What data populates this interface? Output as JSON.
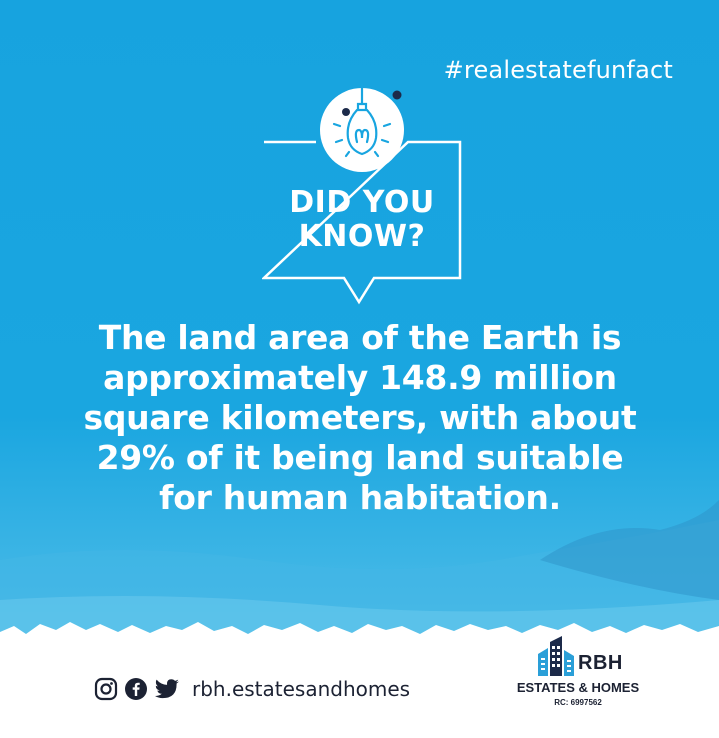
{
  "colors": {
    "sky": "#18a5e0",
    "white": "#ffffff",
    "navy": "#1c2a4a",
    "text_dark": "#1c2233",
    "logo_blue": "#2a9fd8"
  },
  "hashtag": "#realestatefunfact",
  "badge": {
    "line1": "DID YOU",
    "line2": "KNOW?"
  },
  "fact": {
    "lines": [
      "The land area of the Earth is",
      "approximately 148.9 million",
      "square kilometers, with about",
      "29% of it being land suitable",
      "for human habitation."
    ]
  },
  "footer": {
    "social_icons": [
      "instagram-icon",
      "facebook-icon",
      "twitter-icon"
    ],
    "handle": "rbh.estatesandhomes"
  },
  "logo": {
    "name": "RBH",
    "subtitle": "ESTATES & HOMES",
    "rc": "RC: 6997562"
  }
}
